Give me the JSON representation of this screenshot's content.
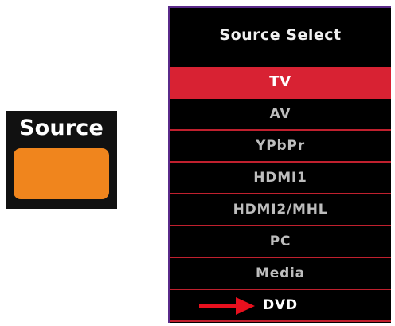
{
  "remote": {
    "label": "Source",
    "button_icon": "orange-rect-button",
    "button_color": "#f0851d"
  },
  "menu": {
    "title": "Source Select",
    "items": [
      {
        "label": "TV",
        "selected": true
      },
      {
        "label": "AV",
        "selected": false
      },
      {
        "label": "YPbPr",
        "selected": false
      },
      {
        "label": "HDMI1",
        "selected": false
      },
      {
        "label": "HDMI2/MHL",
        "selected": false
      },
      {
        "label": "PC",
        "selected": false
      },
      {
        "label": "Media",
        "selected": false
      },
      {
        "label": "DVD",
        "selected": false,
        "pointed": true
      }
    ],
    "highlight_color": "#d82233",
    "divider_color": "#c0202e"
  },
  "annotation": {
    "arrow_icon": "red-right-arrow",
    "arrow_color": "#e8101e"
  }
}
